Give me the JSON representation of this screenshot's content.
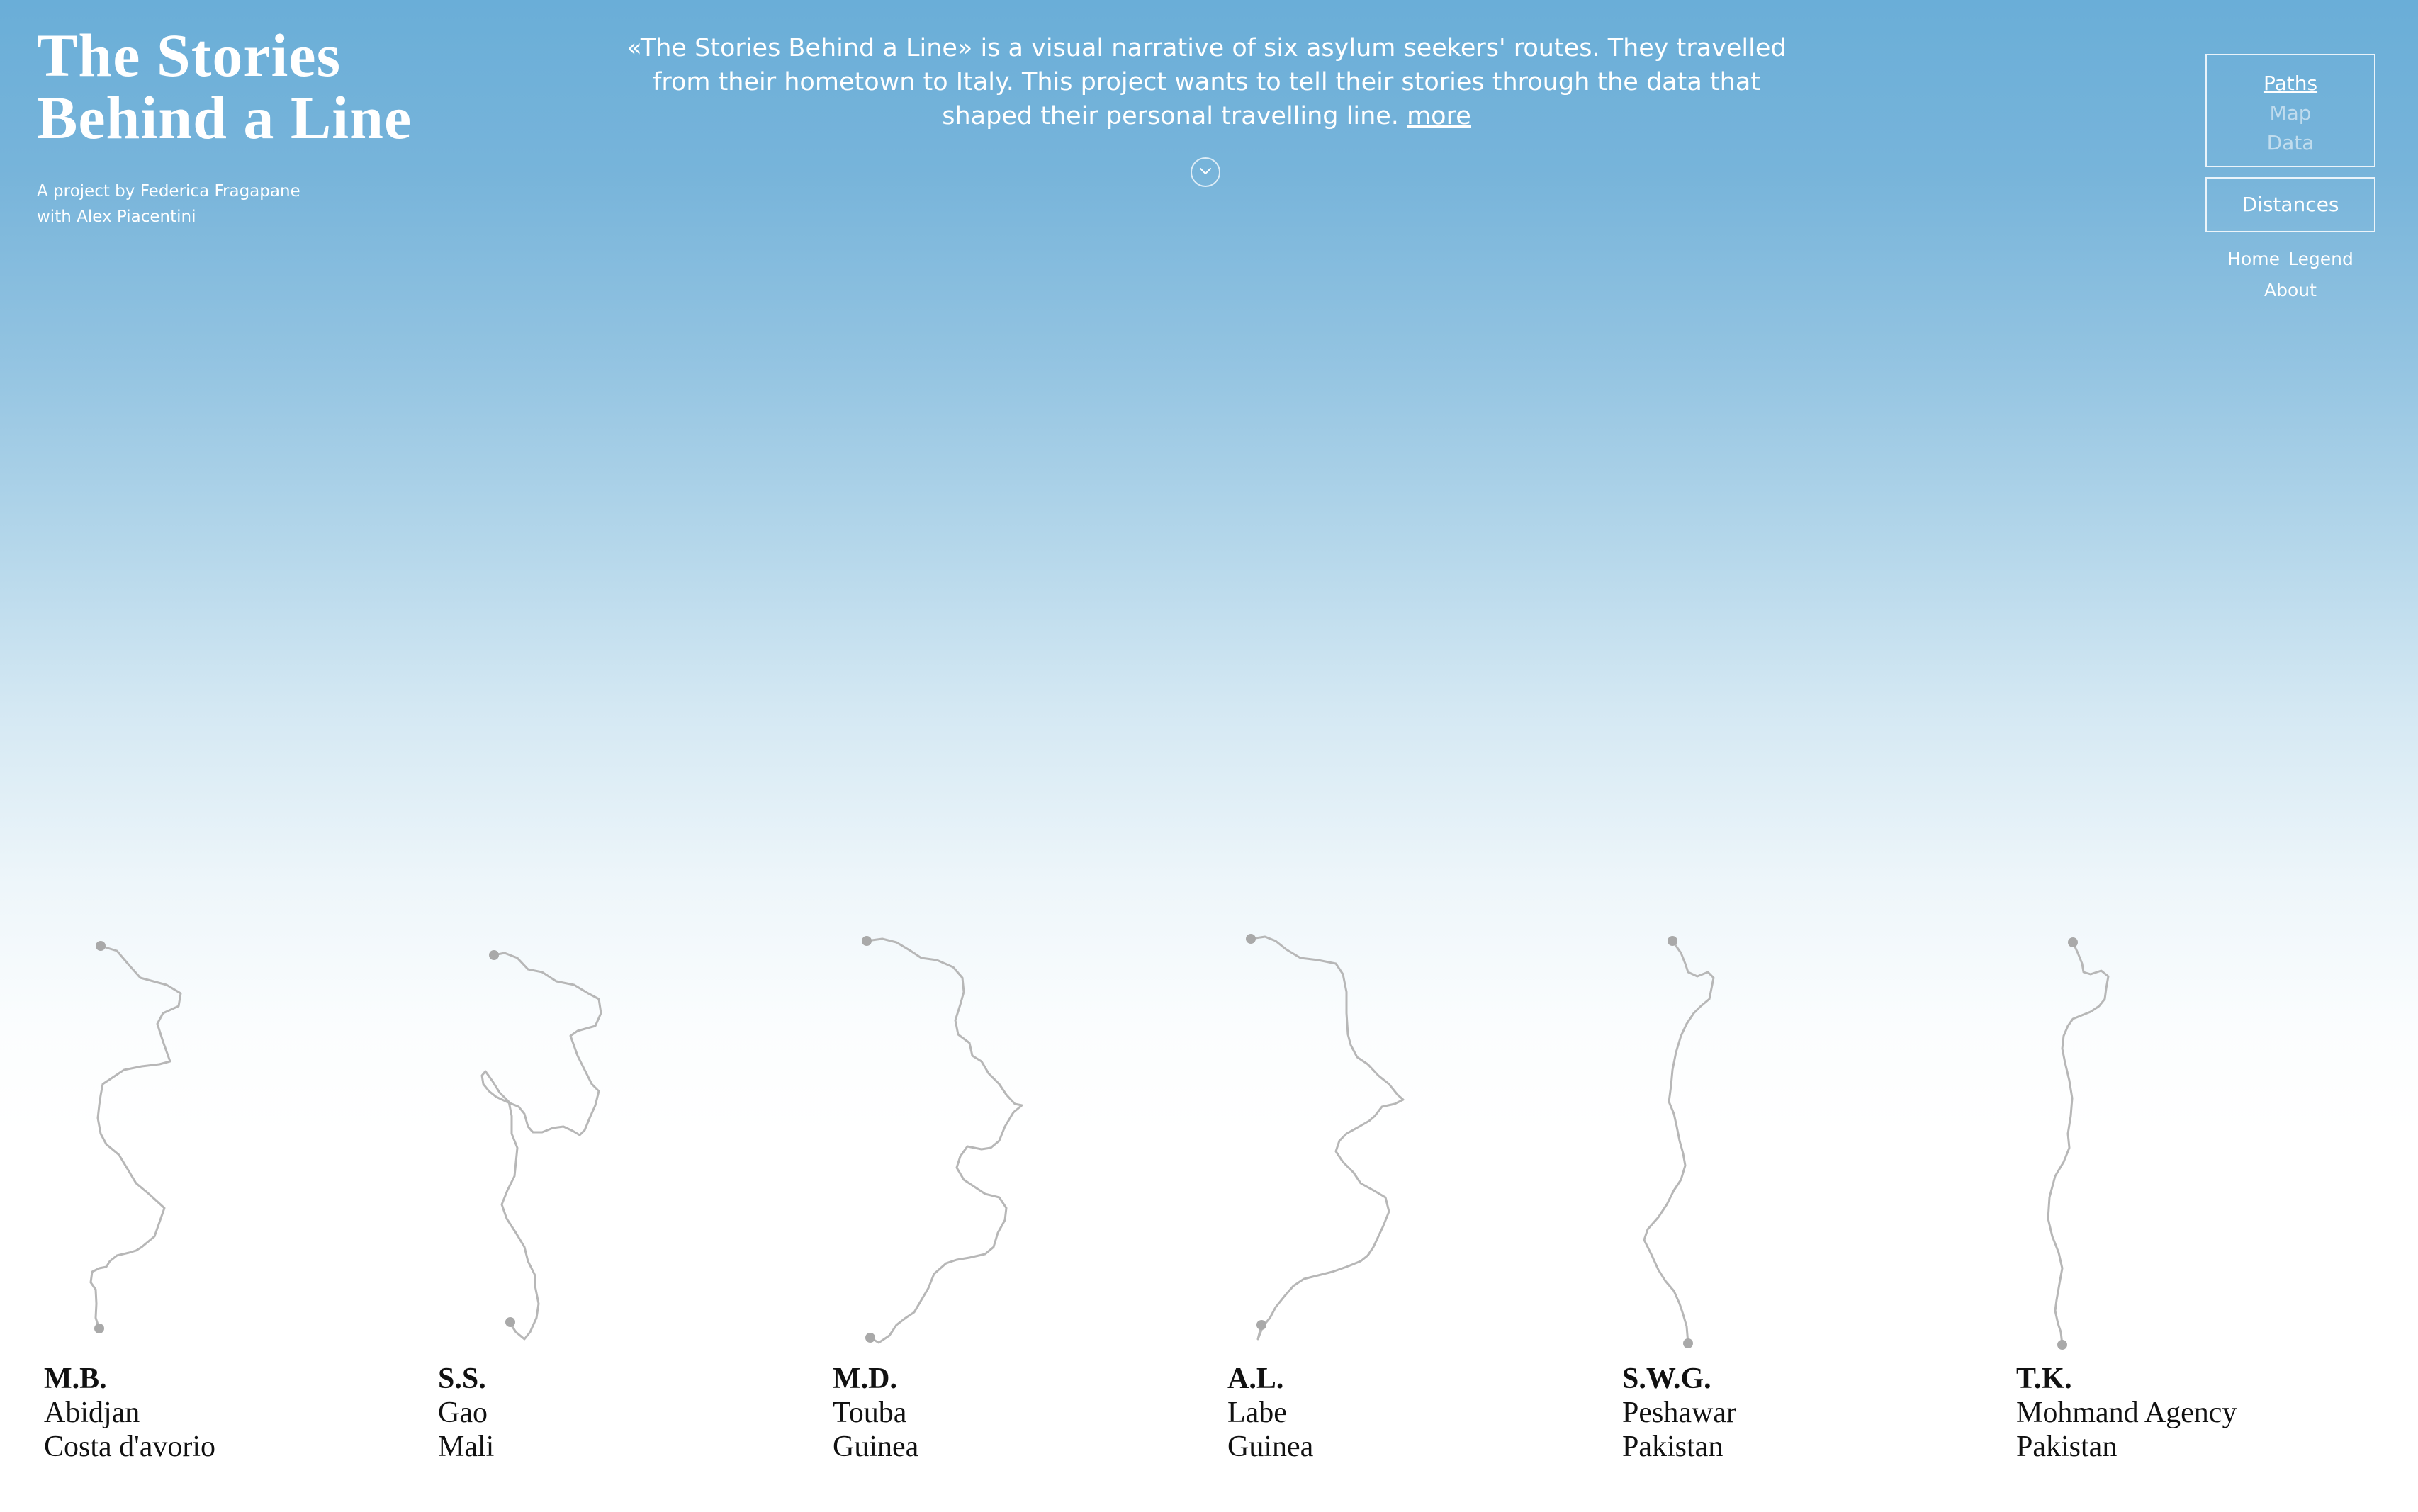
{
  "header": {
    "title_line1": "The Stories",
    "title_line2": "Behind a Line",
    "credit_line1": "A project by Federica Fragapane",
    "credit_line2": "with Alex Piacentini"
  },
  "intro": {
    "text": "«The Stories Behind a Line» is a visual narrative of six asylum seekers' routes. They travelled from their hometown to Italy. This project wants to tell their stories through the data that shaped their personal travelling line.",
    "more_label": "more",
    "scroll_icon": "chevron-down-icon"
  },
  "nav": {
    "views": [
      "Paths",
      "Map",
      "Data"
    ],
    "active_view": "Paths",
    "distances_label": "Distances",
    "home_label": "Home",
    "legend_label": "Legend",
    "about_label": "About"
  },
  "stories": [
    {
      "initials": "M.B.",
      "city": "Abidjan",
      "country": "Costa d'avorio"
    },
    {
      "initials": "S.S.",
      "city": "Gao",
      "country": "Mali"
    },
    {
      "initials": "M.D.",
      "city": "Touba",
      "country": "Guinea"
    },
    {
      "initials": "A.L.",
      "city": "Labe",
      "country": "Guinea"
    },
    {
      "initials": "S.W.G.",
      "city": "Peshawar",
      "country": "Pakistan"
    },
    {
      "initials": "T.K.",
      "city": "Mohmand Agency",
      "country": "Pakistan"
    }
  ],
  "colors": {
    "sky_top": "#6aaed8",
    "route_line": "#b7b7b7",
    "route_dot": "#a9a9a9",
    "text_dark": "#111111"
  }
}
